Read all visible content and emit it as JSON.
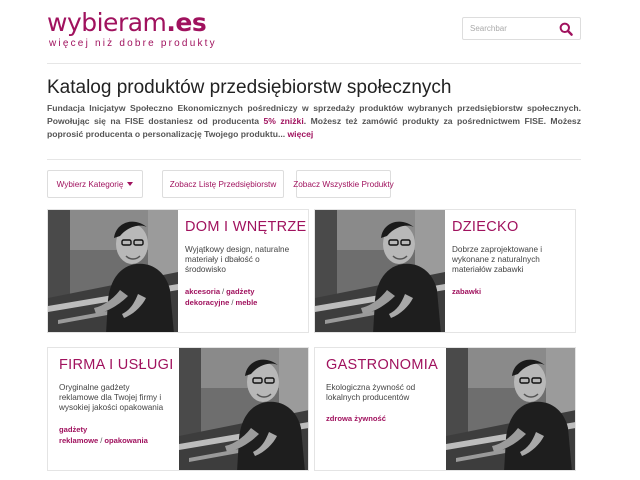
{
  "header": {
    "logo_main": "wybieram",
    "logo_tld": ".es",
    "tagline": "więcej niż dobre produkty",
    "search_placeholder": "Searchbar",
    "search_icon": "search-icon"
  },
  "page": {
    "title": "Katalog produktów przedsiębiorstw społecznych",
    "intro_part1": "Fundacja Inicjatyw Społeczno Ekonomicznych pośredniczy w sprzedaży produktów wybranych przedsiębiorstw społecznych. Powołując się na FISE dostaniesz od producenta ",
    "intro_highlight": "5% zniżki",
    "intro_part2": ". Możesz też zamówić produkty za pośrednictwem FISE. Możesz poprosić producenta o personalizację Twojego produktu... ",
    "intro_more": "więcej"
  },
  "filters": {
    "category": "Wybierz Kategorię",
    "companies": "Zobacz Listę Przedsiębiorstw",
    "all_products": "Zobacz Wszystkie Produkty"
  },
  "colors": {
    "accent": "#a0125e",
    "text": "#333333",
    "border": "#e4e4e4"
  },
  "categories": [
    {
      "title": "DOM I WNĘTRZE",
      "desc": "Wyjątkowy design, naturalne materiały i dbałość o środowisko",
      "tags": [
        "akcesoria",
        "gadżety dekoracyjne",
        "meble"
      ]
    },
    {
      "title": "DZIECKO",
      "desc": "Dobrze zaprojektowane i wykonane z naturalnych materiałów zabawki",
      "tags": [
        "zabawki"
      ]
    },
    {
      "title": "FIRMA I USŁUGI",
      "desc": "Oryginalne gadżety reklamowe dla Twojej firmy i wysokiej jakości opakowania",
      "tags": [
        "gadżety reklamowe",
        "opakowania"
      ]
    },
    {
      "title": "GASTRONOMIA",
      "desc": "Ekologiczna żywność od lokalnych producentów",
      "tags": [
        "zdrowa żywność"
      ]
    }
  ]
}
